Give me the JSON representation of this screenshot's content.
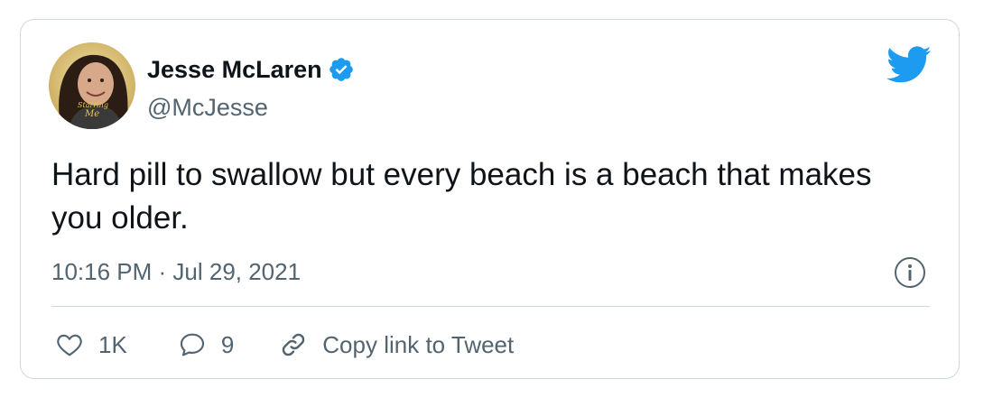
{
  "author": {
    "name": "Jesse McLaren",
    "handle": "@McJesse",
    "avatar_caption": "Starring Me"
  },
  "tweet": {
    "text": "Hard pill to swallow but every beach is a beach that makes you older.",
    "timestamp": "10:16 PM · Jul 29, 2021"
  },
  "actions": {
    "like_count": "1K",
    "reply_count": "9",
    "copy_link_label": "Copy link to Tweet"
  },
  "icons": {
    "brand": "twitter-bird-icon",
    "verified": "verified-badge-icon",
    "info": "info-icon",
    "like": "heart-icon",
    "reply": "reply-bubble-icon",
    "link": "link-icon"
  },
  "colors": {
    "twitter_blue": "#1d9bf0",
    "text_primary": "#0f1419",
    "text_secondary": "#536471",
    "border": "#cfd9de"
  }
}
